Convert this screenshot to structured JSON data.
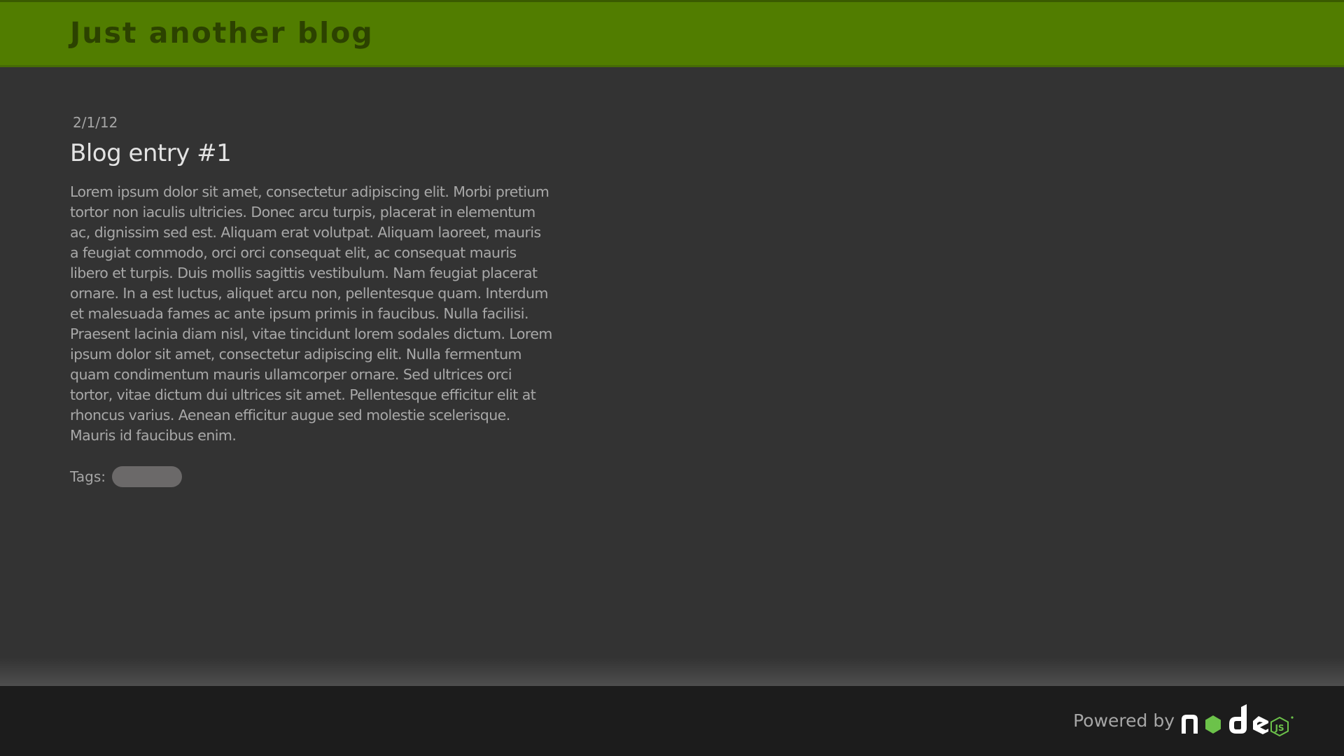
{
  "header": {
    "site_title": "Just another blog"
  },
  "post": {
    "date": "2/1/12",
    "title": "Blog entry #1",
    "body": "Lorem ipsum dolor sit amet, consectetur adipiscing elit. Morbi pretium tortor non iaculis ultricies. Donec arcu turpis, placerat in elementum ac, dignissim sed est. Aliquam erat volutpat. Aliquam laoreet, mauris a feugiat commodo, orci orci consequat elit, ac consequat mauris libero et turpis. Duis mollis sagittis vestibulum. Nam feugiat placerat ornare. In a est luctus, aliquet arcu non, pellentesque quam. Interdum et malesuada fames ac ante ipsum primis in faucibus. Nulla facilisi. Praesent lacinia diam nisl, vitae tincidunt lorem sodales dictum. Lorem ipsum dolor sit amet, consectetur adipiscing elit. Nulla fermentum quam condimentum mauris ullamcorper ornare. Sed ultrices orci tortor, vitae dictum dui ultrices sit amet. Pellentesque efficitur elit at rhoncus varius. Aenean efficitur augue sed molestie scelerisque. Mauris id faucibus enim.",
    "tags_label": "Tags:",
    "tags": [
      ""
    ]
  },
  "footer": {
    "powered_by_label": "Powered by",
    "logo_icon": "nodejs-logo-icon"
  },
  "colors": {
    "header_bg": "#517d00",
    "site_title": "#2c4200",
    "page_bg": "#333333",
    "footer_bg": "#1c1c1c",
    "tag_pill": "#6b6969",
    "node_green": "#6cc24a"
  }
}
